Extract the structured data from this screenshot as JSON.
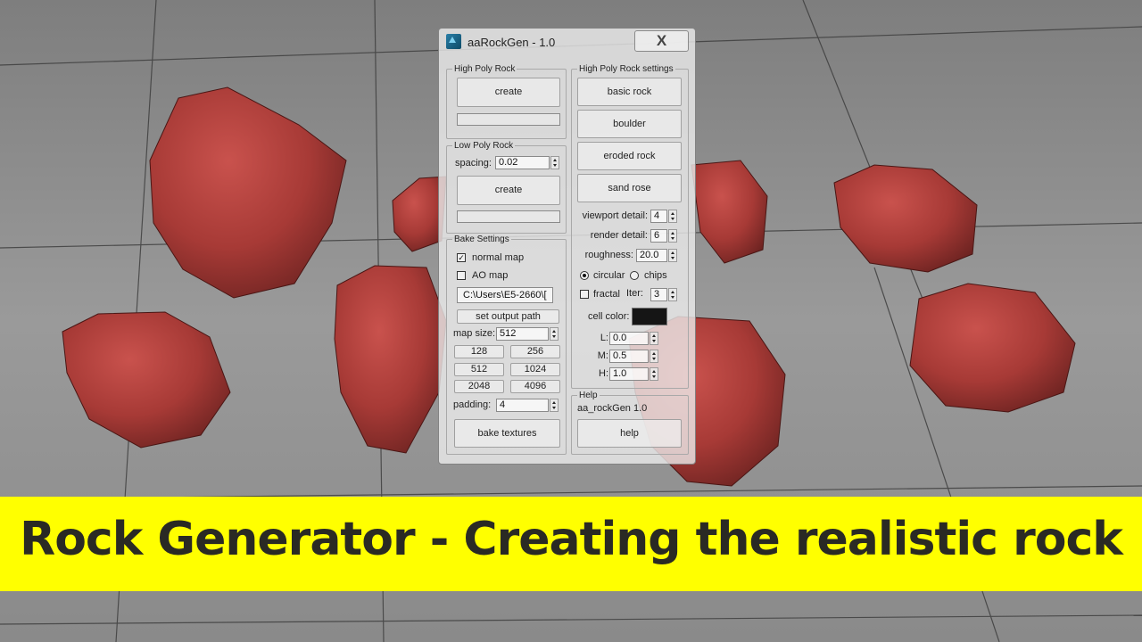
{
  "window": {
    "title": "aaRockGen - 1.0",
    "close_label": "X"
  },
  "high_poly_rock": {
    "legend": "High Poly Rock",
    "create_label": "create"
  },
  "low_poly_rock": {
    "legend": "Low Poly Rock",
    "spacing_label": "spacing:",
    "spacing_value": "0.02",
    "create_label": "create"
  },
  "bake_settings": {
    "legend": "Bake Settings",
    "normal_map_label": "normal map",
    "normal_map_checked": true,
    "ao_map_label": "AO map",
    "ao_map_checked": false,
    "output_path": "C:\\Users\\E5-2660\\[",
    "set_output_path_label": "set output path",
    "map_size_label": "map size:",
    "map_size_value": "512",
    "size_buttons": [
      "128",
      "256",
      "512",
      "1024",
      "2048",
      "4096"
    ],
    "padding_label": "padding:",
    "padding_value": "4",
    "bake_label": "bake textures"
  },
  "settings": {
    "legend": "High Poly Rock settings",
    "presets": [
      "basic rock",
      "boulder",
      "eroded rock",
      "sand rose"
    ],
    "viewport_detail_label": "viewport detail:",
    "viewport_detail_value": "4",
    "render_detail_label": "render detail:",
    "render_detail_value": "6",
    "roughness_label": "roughness:",
    "roughness_value": "20.0",
    "circular_label": "circular",
    "chips_label": "chips",
    "selected_shape": "circular",
    "fractal_label": "fractal",
    "fractal_checked": false,
    "iter_label": "Iter:",
    "iter_value": "3",
    "cell_color_label": "cell color:",
    "cell_color": "#151515",
    "l_label": "L:",
    "l_value": "0.0",
    "m_label": "M:",
    "m_value": "0.5",
    "h_label": "H:",
    "h_value": "1.0"
  },
  "help": {
    "legend": "Help",
    "version_text": "aa_rockGen 1.0",
    "help_label": "help"
  },
  "banner": {
    "text": "Rock Generator - Creating the realistic rock",
    "background": "#ffff00"
  },
  "colors": {
    "rock": "#a63a37",
    "floor": "#8d8d8d",
    "grid": "#3a3a3a"
  }
}
